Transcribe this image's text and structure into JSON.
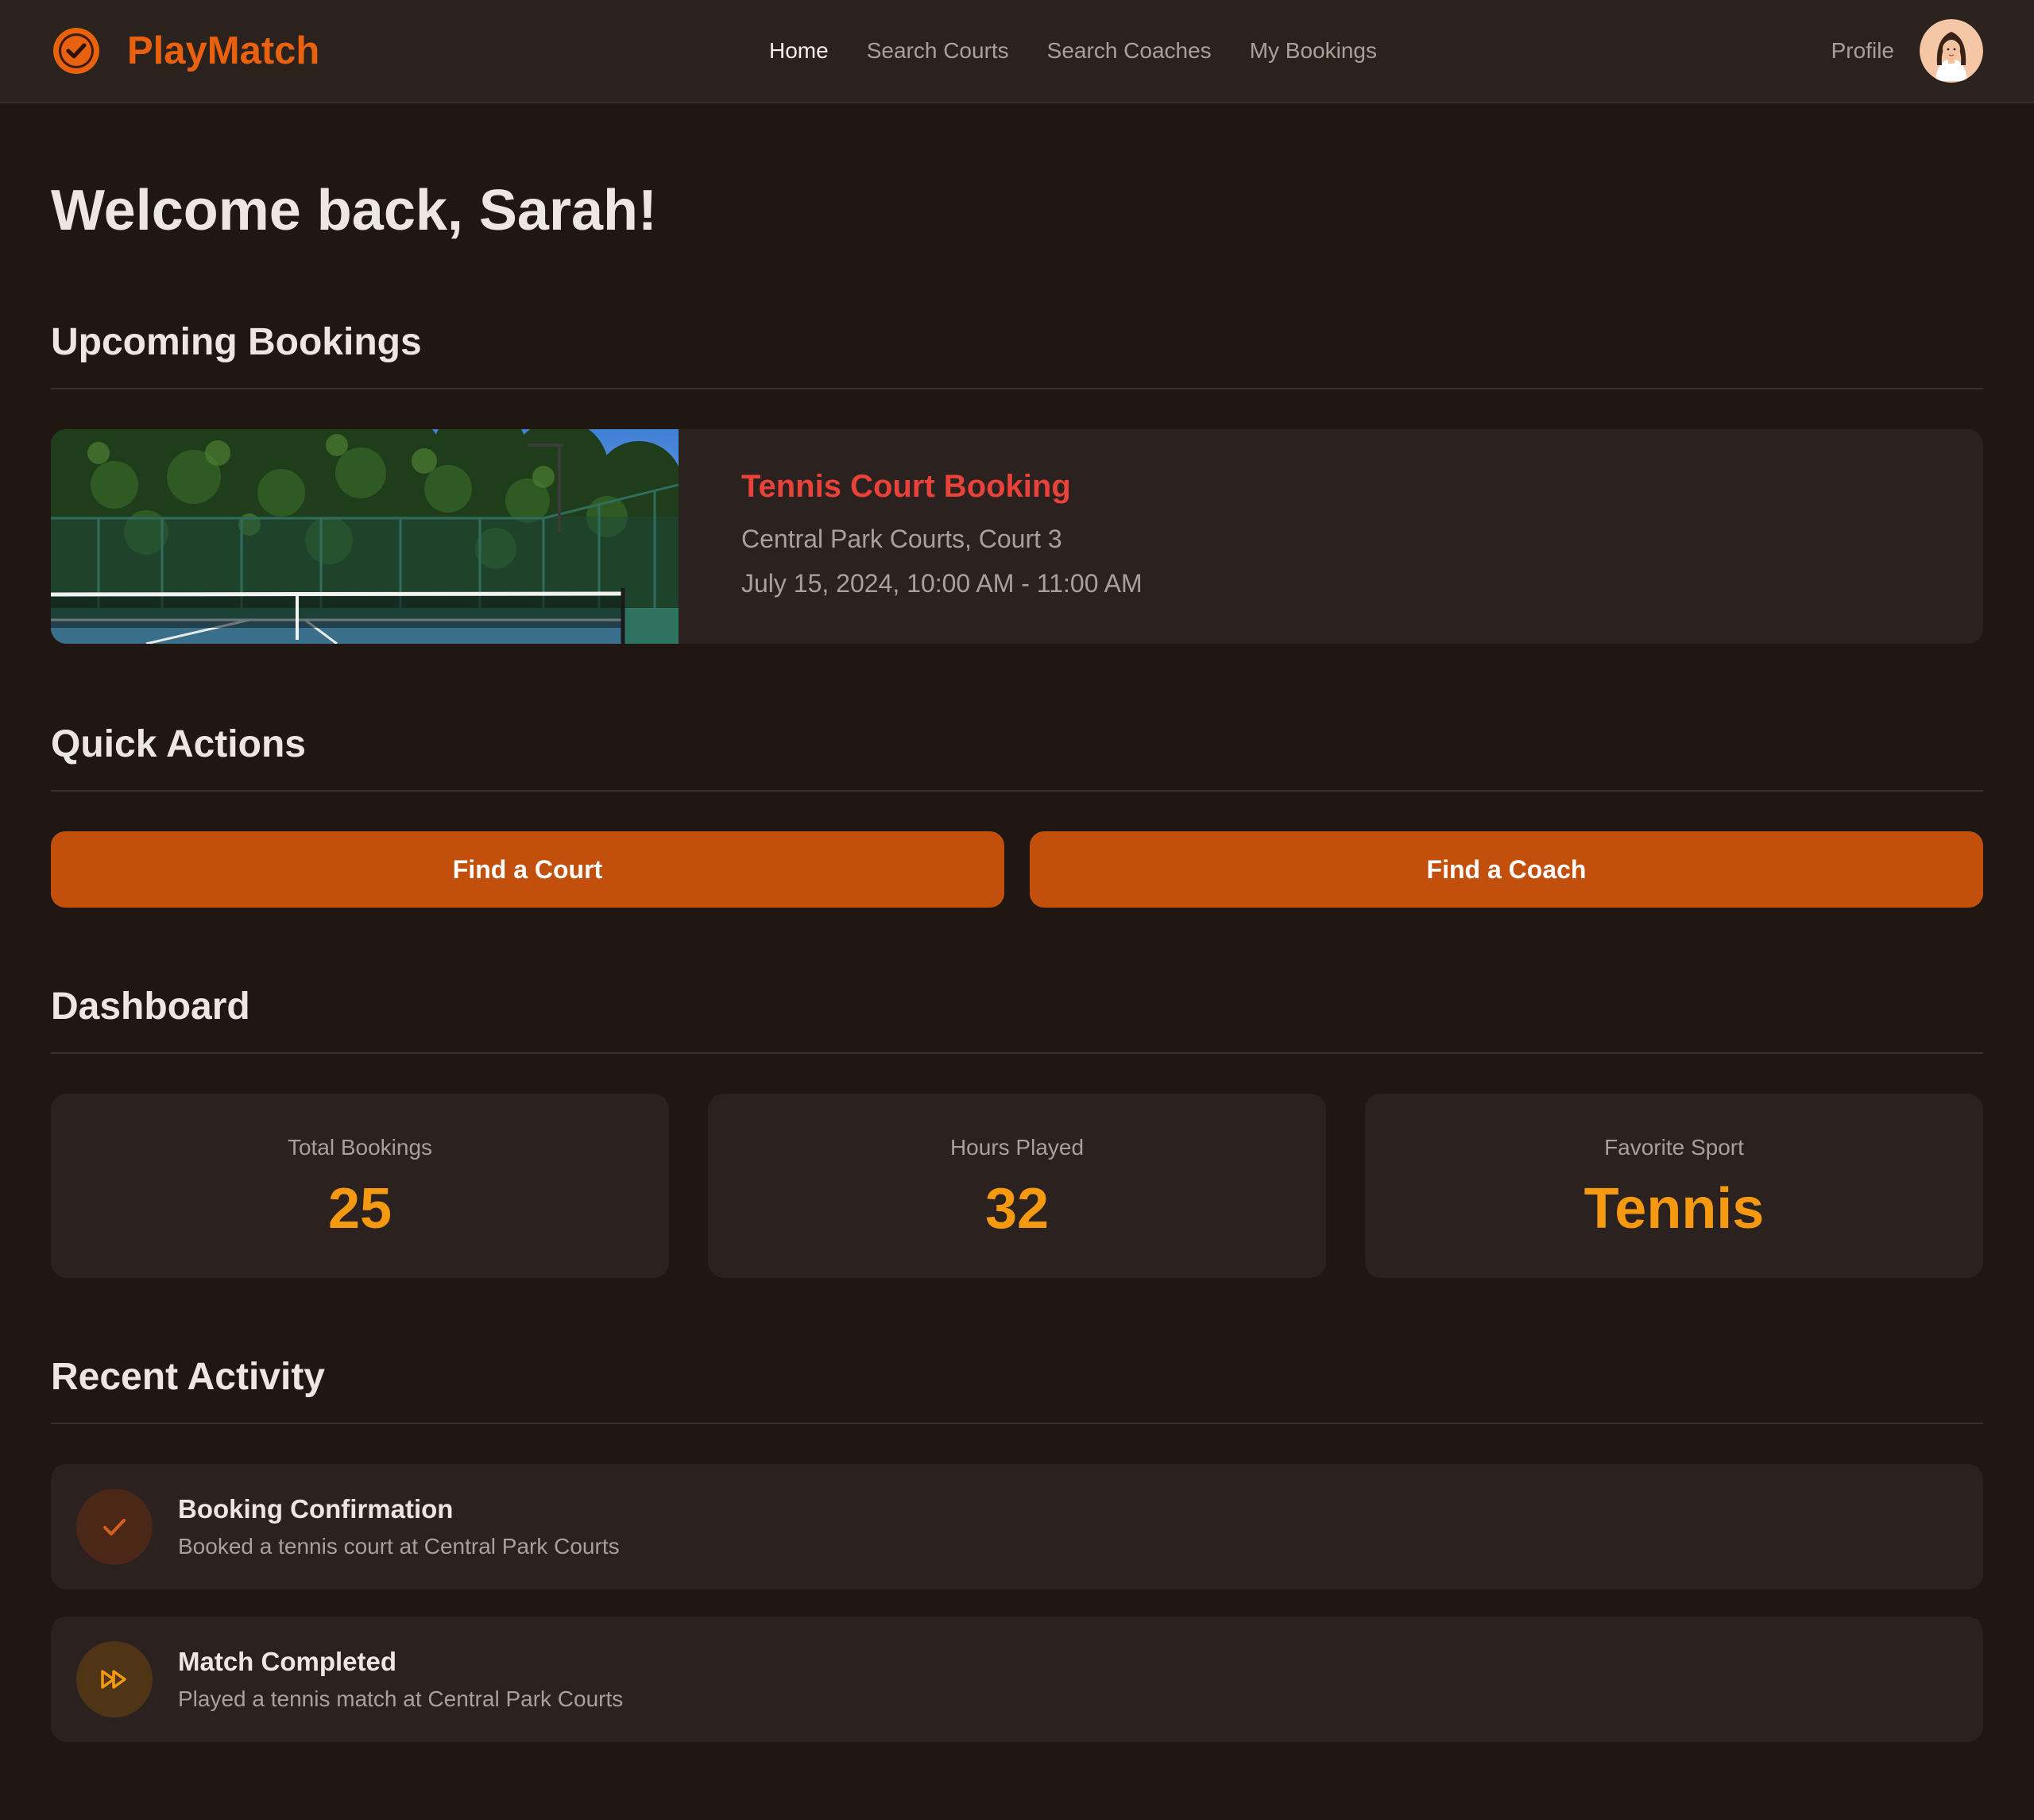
{
  "header": {
    "brand": "PlayMatch",
    "logo_icon": "check-circle-icon",
    "nav": [
      {
        "label": "Home",
        "active": true
      },
      {
        "label": "Search Courts",
        "active": false
      },
      {
        "label": "Search Coaches",
        "active": false
      },
      {
        "label": "My Bookings",
        "active": false
      }
    ],
    "profile_label": "Profile"
  },
  "welcome": "Welcome back, Sarah!",
  "sections": {
    "upcoming": "Upcoming Bookings",
    "quick_actions": "Quick Actions",
    "dashboard": "Dashboard",
    "recent_activity": "Recent Activity"
  },
  "booking": {
    "title": "Tennis Court Booking",
    "location": "Central Park Courts, Court 3",
    "time": "July 15, 2024, 10:00 AM - 11:00 AM"
  },
  "actions": {
    "find_court": "Find a Court",
    "find_coach": "Find a Coach"
  },
  "dashboard": [
    {
      "label": "Total Bookings",
      "value": "25"
    },
    {
      "label": "Hours Played",
      "value": "32"
    },
    {
      "label": "Favorite Sport",
      "value": "Tennis"
    }
  ],
  "activity": [
    {
      "title": "Booking Confirmation",
      "desc": "Booked a tennis court at Central Park Courts",
      "icon": "check-icon"
    },
    {
      "title": "Match Completed",
      "desc": "Played a tennis match at Central Park Courts",
      "icon": "fast-forward-icon"
    }
  ],
  "colors": {
    "background": "#201713",
    "surface": "#2b211f",
    "brand": "#e8610f",
    "button": "#c34f0c",
    "stat_value": "#f59a10",
    "booking_title": "#e8423a"
  }
}
